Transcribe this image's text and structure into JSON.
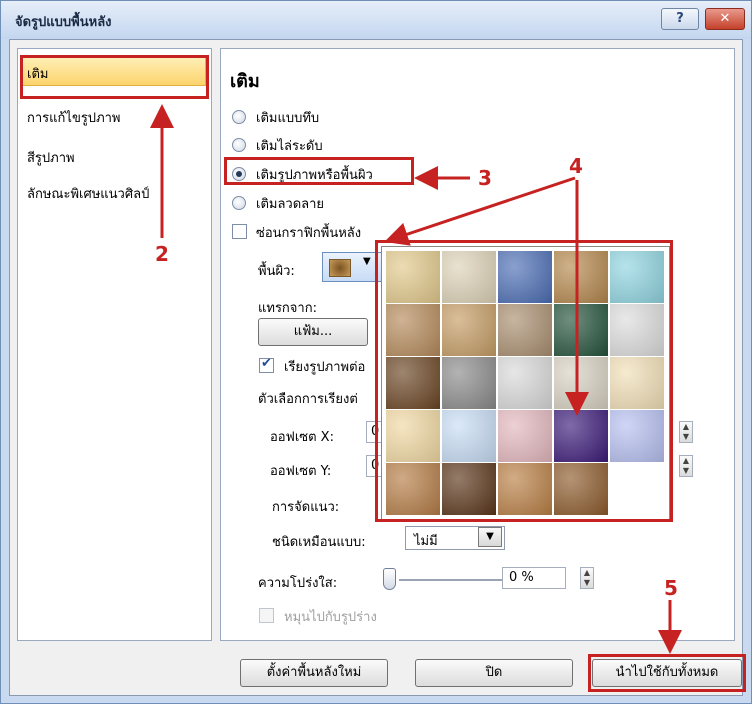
{
  "window": {
    "title": "จัดรูปแบบพื้นหลัง",
    "help_label": "?",
    "close_label": "✕"
  },
  "sidebar": {
    "items": [
      {
        "label": "เติม",
        "selected": true
      },
      {
        "label": "การแก้ไขรูปภาพ",
        "selected": false
      },
      {
        "label": "สีรูปภาพ",
        "selected": false
      },
      {
        "label": "ลักษณะพิเศษแนวศิลป์",
        "selected": false
      }
    ]
  },
  "main": {
    "heading": "เติม",
    "fill_options": [
      {
        "label": "เติมแบบทึบ",
        "selected": false
      },
      {
        "label": "เติมไล่ระดับ",
        "selected": false
      },
      {
        "label": "เติมรูปภาพหรือพื้นผิว",
        "selected": true
      },
      {
        "label": "เติมลวดลาย",
        "selected": false
      }
    ],
    "hide_background_label": "ซ่อนกราฟิกพื้นหลัง",
    "hide_background_checked": false,
    "texture_label": "พื้นผิว:",
    "insert_from_label": "แทรกจาก:",
    "file_button": "แฟ้ม...",
    "tile_label": "เรียงรูปภาพต่อ",
    "tile_checked": true,
    "tile_options_label": "ตัวเลือกการเรียงต่",
    "offset_x_label": "ออฟเซต X:",
    "offset_x_value": "0",
    "offset_y_label": "ออฟเซต Y:",
    "offset_y_value": "0",
    "alignment_label": "การจัดแนว:",
    "mirror_label": "ชนิดเหมือนแบบ:",
    "mirror_value": "ไม่มี",
    "transparency_label": "ความโปร่งใส:",
    "transparency_value": "0 %",
    "transparency_level": 0,
    "rotate_label": "หมุนไปกับรูปร่าง",
    "rotate_checked": false
  },
  "footer": {
    "reset_button": "ตั้งค่าพื้นหลังใหม่",
    "close_button": "ปิด",
    "apply_all_button": "นำไปใช้กับทั้งหมด"
  },
  "texture_gallery": {
    "swatches": [
      {
        "name": "papyrus",
        "color": "#e2c98b"
      },
      {
        "name": "canvas",
        "color": "#ddd2b7"
      },
      {
        "name": "denim",
        "color": "#4b6db4"
      },
      {
        "name": "woven-mat",
        "color": "#b4874c"
      },
      {
        "name": "water-droplets",
        "color": "#8fd4e0"
      },
      {
        "name": "paper-bag",
        "color": "#b58a5a"
      },
      {
        "name": "fish-fossil",
        "color": "#c59c64"
      },
      {
        "name": "sand",
        "color": "#a98e6f"
      },
      {
        "name": "green-marble",
        "color": "#23523a"
      },
      {
        "name": "white-marble",
        "color": "#dcdcdc"
      },
      {
        "name": "brown-marble",
        "color": "#6a4422"
      },
      {
        "name": "granite",
        "color": "#8a8a8a"
      },
      {
        "name": "newsprint",
        "color": "#d9d9d9"
      },
      {
        "name": "recycled-paper",
        "color": "#d8d1c2"
      },
      {
        "name": "parchment",
        "color": "#f1dfb6"
      },
      {
        "name": "stationery",
        "color": "#f0d8a2"
      },
      {
        "name": "blue-tissue-paper",
        "color": "#c7dcf4"
      },
      {
        "name": "pink-tissue-paper",
        "color": "#e3b7bd"
      },
      {
        "name": "purple-mesh",
        "color": "#3b1a78"
      },
      {
        "name": "bouquet",
        "color": "#b6bff0"
      },
      {
        "name": "cork",
        "color": "#b57c45"
      },
      {
        "name": "walnut",
        "color": "#5a3519"
      },
      {
        "name": "oak",
        "color": "#b97f44"
      },
      {
        "name": "medium-wood",
        "color": "#8c5a2b"
      }
    ]
  },
  "annotations": {
    "numbers": [
      "2",
      "3",
      "4",
      "5"
    ],
    "color": "#c62222"
  }
}
